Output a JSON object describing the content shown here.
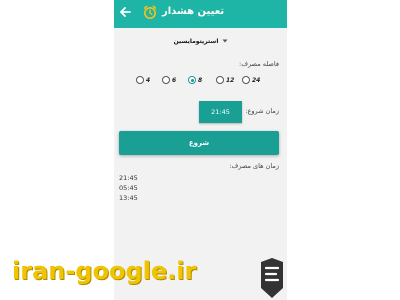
{
  "app": {
    "title": "تعیین هشدار",
    "accent_color": "#1fb5a6",
    "button_color": "#1a9f95"
  },
  "icons": {
    "back": "arrow-left-icon",
    "alarm": "alarm-clock-icon",
    "dropdown": "caret-down-icon",
    "logo": "bookmark-logo-icon"
  },
  "drug_select": {
    "selected": "استرپتومایسین"
  },
  "interval": {
    "label": "فاصله مصرف:",
    "options": [
      "4",
      "6",
      "8",
      "12",
      "24"
    ],
    "selected": "8"
  },
  "start_time": {
    "label": "زمان شروع:",
    "value": "21:45"
  },
  "start_button": {
    "label": "شروع"
  },
  "times": {
    "label": "زمان های مصرف:",
    "items": [
      "21:45",
      "05:45",
      "13:45"
    ]
  },
  "watermark": {
    "text": "iran-google.ir"
  }
}
